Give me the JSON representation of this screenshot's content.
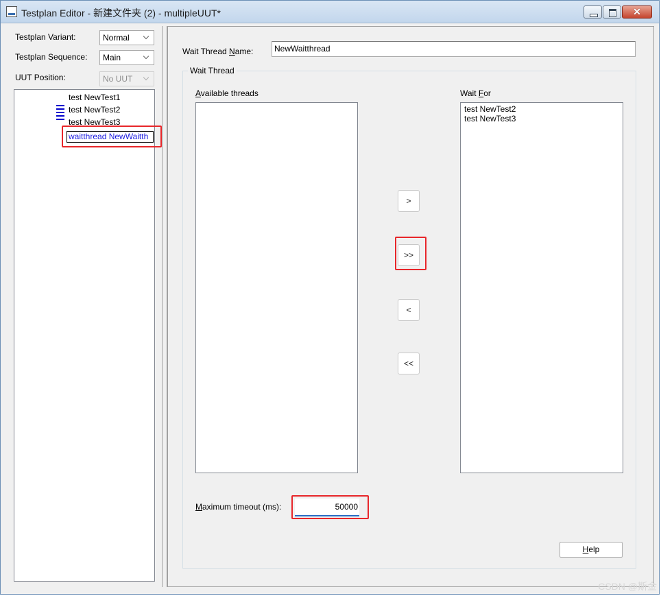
{
  "window": {
    "title": "Testplan Editor - 新建文件夹 (2) - multipleUUT*"
  },
  "left": {
    "variant_label": "Testplan Variant:",
    "variant_value": "Normal",
    "sequence_label": "Testplan Sequence:",
    "sequence_value": "Main",
    "uut_label": "UUT Position:",
    "uut_value": "No UUT",
    "tree_items": [
      "test NewTest1",
      "test NewTest2",
      "test NewTest3"
    ],
    "selected_item": "waitthread NewWaitth"
  },
  "form": {
    "name_label_pre": "Wait Thread ",
    "name_label_ul": "N",
    "name_label_post": "ame:",
    "name_value": "NewWaitthread",
    "group_title": "Wait Thread",
    "available_ul": "A",
    "available_rest": "vailable threads",
    "waitfor_pre": "Wait ",
    "waitfor_ul": "F",
    "waitfor_post": "or",
    "available_items": [],
    "waitfor_items": [
      "test NewTest2",
      "test NewTest3"
    ],
    "btn_add": ">",
    "btn_add_all": ">>",
    "btn_remove": "<",
    "btn_remove_all": "<<",
    "timeout_ul": "M",
    "timeout_rest": "aximum timeout (ms):",
    "timeout_value": "50000",
    "help_ul": "H",
    "help_rest": "elp"
  },
  "watermark": "CSDN @斯金",
  "colors": {
    "highlight": "#e8262a",
    "tree_lines": "#0000cc",
    "selected_text": "#1a1adf"
  }
}
